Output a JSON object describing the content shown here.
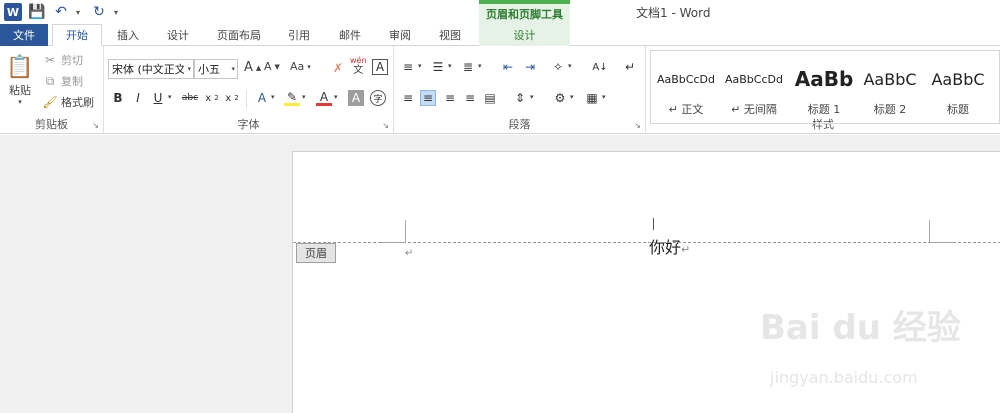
{
  "titlebar": {
    "doc_title": "文档1 - Word",
    "context_group": "页眉和页脚工具",
    "accent_color": "#2b579a",
    "context_color": "#4caf50"
  },
  "tabs": [
    {
      "label": "文件"
    },
    {
      "label": "开始"
    },
    {
      "label": "插入"
    },
    {
      "label": "设计"
    },
    {
      "label": "页面布局"
    },
    {
      "label": "引用"
    },
    {
      "label": "邮件"
    },
    {
      "label": "审阅"
    },
    {
      "label": "视图"
    },
    {
      "label": "设计"
    }
  ],
  "clipboard": {
    "paste": "粘贴",
    "cut": "剪切",
    "copy": "复制",
    "format_painter": "格式刷",
    "label": "剪贴板"
  },
  "font": {
    "family": "宋体 (中文正文",
    "size": "小五",
    "label": "字体",
    "aa": "Aa",
    "pinyin": "wén"
  },
  "paragraph": {
    "label": "段落"
  },
  "styles": {
    "label": "样式",
    "items": [
      {
        "preview": "AaBbCcDd",
        "name": "↵ 正文"
      },
      {
        "preview": "AaBbCcDd",
        "name": "↵ 无间隔"
      },
      {
        "preview": "AaBb",
        "name": "标题 1"
      },
      {
        "preview": "AaBbC",
        "name": "标题 2"
      },
      {
        "preview": "AaBbC",
        "name": "标题"
      }
    ]
  },
  "document": {
    "header_text": "你好",
    "header_tag": "页眉",
    "para_mark": "↵"
  },
  "watermark": {
    "brand": "Bai du 经验",
    "url": "jingyan.baidu.com"
  }
}
